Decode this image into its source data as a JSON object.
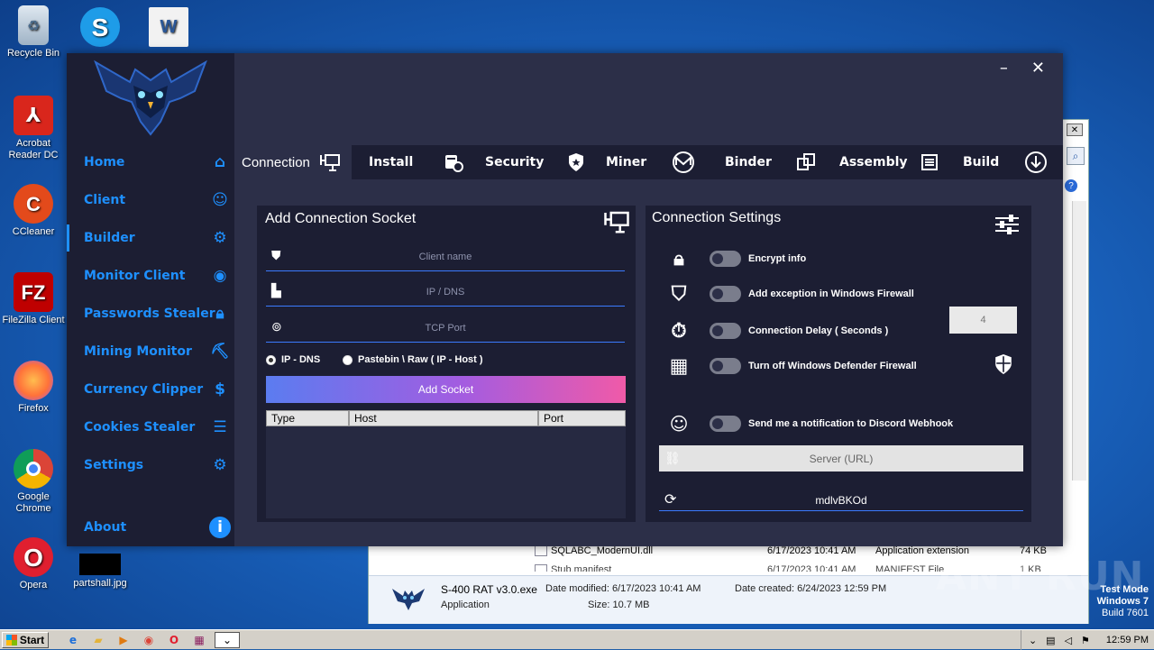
{
  "desktop": {
    "icons": [
      {
        "label": "Recycle Bin",
        "icon": "recycle-bin-icon"
      },
      {
        "label": "",
        "icon": "skype-icon"
      },
      {
        "label": "",
        "icon": "word-doc-icon"
      },
      {
        "label": "Acrobat Reader DC",
        "icon": "acrobat-icon"
      },
      {
        "label": "CCleaner",
        "icon": "ccleaner-icon"
      },
      {
        "label": "FileZilla Client",
        "icon": "filezilla-icon"
      },
      {
        "label": "Firefox",
        "icon": "firefox-icon"
      },
      {
        "label": "Google Chrome",
        "icon": "chrome-icon"
      },
      {
        "label": "Opera",
        "icon": "opera-icon"
      },
      {
        "label": "partshall.jpg",
        "icon": "image-file-icon"
      }
    ],
    "watermark": "ANY RUN",
    "test_mode": {
      "line1": "Test Mode",
      "line2": "Windows 7",
      "line3": "Build 7601"
    }
  },
  "explorer": {
    "row1": {
      "name": "SQLABC_ModernUI.dll",
      "date": "6/17/2023 10:41 AM",
      "type": "Application extension",
      "size": "74 KB"
    },
    "row2": {
      "name": "Stub.manifest",
      "date": "6/17/2023 10:41 AM",
      "type": "MANIFEST File",
      "size": "1 KB"
    },
    "details": {
      "filename": "S-400 RAT v3.0.exe",
      "modified_label": "Date modified:",
      "modified": "6/17/2023 10:41 AM",
      "created_label": "Date created:",
      "created": "6/24/2023 12:59 PM",
      "kind": "Application",
      "size_label": "Size:",
      "size": "10.7 MB"
    }
  },
  "app": {
    "window_controls": {
      "minimize": "–",
      "close": "✕"
    },
    "sidebar": [
      {
        "label": "Home",
        "icon": "home-icon"
      },
      {
        "label": "Client",
        "icon": "users-icon"
      },
      {
        "label": "Builder",
        "icon": "gear-icon"
      },
      {
        "label": "Monitor Client",
        "icon": "eye-icon"
      },
      {
        "label": "Passwords Stealer",
        "icon": "lock-icon"
      },
      {
        "label": "Mining Monitor",
        "icon": "pickaxe-icon"
      },
      {
        "label": "Currency Clipper",
        "icon": "dollar-icon"
      },
      {
        "label": "Cookies Stealer",
        "icon": "list-gear-icon"
      },
      {
        "label": "Settings",
        "icon": "user-gear-icon"
      },
      {
        "label": "About",
        "icon": "info-icon"
      }
    ],
    "active_sidebar": "Builder",
    "tabs": [
      {
        "label": "Connection"
      },
      {
        "label": "Install"
      },
      {
        "label": "Security"
      },
      {
        "label": "Miner"
      },
      {
        "label": "Binder"
      },
      {
        "label": "Assembly"
      },
      {
        "label": "Build"
      }
    ],
    "active_tab": "Connection",
    "socket_panel": {
      "title": "Add Connection Socket",
      "client_name_placeholder": "Client name",
      "ip_placeholder": "IP / DNS",
      "port_placeholder": "TCP Port",
      "radio_ipdns": "IP - DNS",
      "radio_pastebin": "Pastebin \\ Raw ( IP - Host )",
      "radio_selected": "IP - DNS",
      "add_button": "Add Socket",
      "columns": [
        "Type",
        "Host",
        "Port"
      ],
      "rows": []
    },
    "settings_panel": {
      "title": "Connection Settings",
      "encrypt": "Encrypt info",
      "firewall_exception": "Add exception in Windows Firewall",
      "delay": "Connection Delay  ( Seconds )",
      "delay_value": "4",
      "defender": "Turn off  Windows Defender Firewall",
      "discord": "Send me a notification to Discord Webhook",
      "server_placeholder": "Server (URL)",
      "mutex": "mdlvBKOd",
      "toggles": {
        "encrypt": false,
        "firewall_exception": false,
        "delay": false,
        "defender": false,
        "discord": false
      }
    }
  },
  "taskbar": {
    "start": "Start",
    "clock": "12:59 PM"
  },
  "colors": {
    "accent": "#1e90ff",
    "panel": "#1c1e33",
    "window": "#2c2f48",
    "underline": "#3b7bff"
  }
}
